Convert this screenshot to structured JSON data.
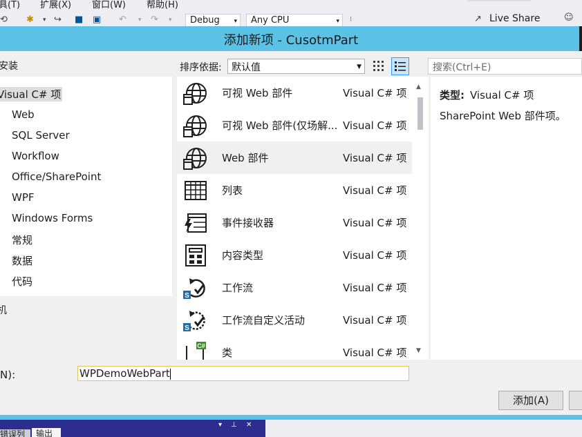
{
  "menubar": {
    "items": [
      "具(T)",
      "扩展(X)",
      "窗口(W)",
      "帮助(H)"
    ]
  },
  "toolbar": {
    "config_combo": "Debug",
    "platform_combo": "Any CPU",
    "live_share_label": "Live Share"
  },
  "dialog": {
    "title": "添加新项 - CusotmPart",
    "sort_label": "排序依据:",
    "sort_value": "默认值",
    "search_placeholder": "搜索(Ctrl+E)",
    "tree": {
      "installed_header": "安装",
      "visual_csharp_item": "Visual C# 项",
      "children": [
        "Web",
        "SQL Server",
        "Workflow",
        "Office/SharePoint",
        "WPF",
        "Windows Forms",
        "常规",
        "数据",
        "代码"
      ],
      "online_header": "机"
    },
    "templates": [
      {
        "name": "可视 Web 部件",
        "type": "Visual C# 项",
        "icon": "globe-icon"
      },
      {
        "name": "可视 Web 部件(仅场解...",
        "type": "Visual C# 项",
        "icon": "globe-icon"
      },
      {
        "name": "Web 部件",
        "type": "Visual C# 项",
        "icon": "globe-icon"
      },
      {
        "name": "列表",
        "type": "Visual C# 项",
        "icon": "list-grid-icon"
      },
      {
        "name": "事件接收器",
        "type": "Visual C# 项",
        "icon": "event-receiver-icon"
      },
      {
        "name": "内容类型",
        "type": "Visual C# 项",
        "icon": "content-type-icon"
      },
      {
        "name": "工作流",
        "type": "Visual C# 项",
        "icon": "workflow-icon"
      },
      {
        "name": "工作流自定义活动",
        "type": "Visual C# 项",
        "icon": "workflow-icon"
      },
      {
        "name": "类",
        "type": "Visual C# 项",
        "icon": "csharp-class-icon"
      }
    ],
    "selected_template_index": 2,
    "description": {
      "type_label": "类型:",
      "type_value": "Visual C# 项",
      "text": "SharePoint Web 部件项。"
    },
    "name_label": "N):",
    "name_value": "WPDemoWebPart",
    "add_button": "添加(A)"
  },
  "bottom": {
    "tab_list": "错误列表",
    "tab_output": "输出"
  },
  "colors": {
    "title_bar": "#5bc2e6",
    "selection": "#cce4f7",
    "bottom_bar": "#2d2d90"
  }
}
